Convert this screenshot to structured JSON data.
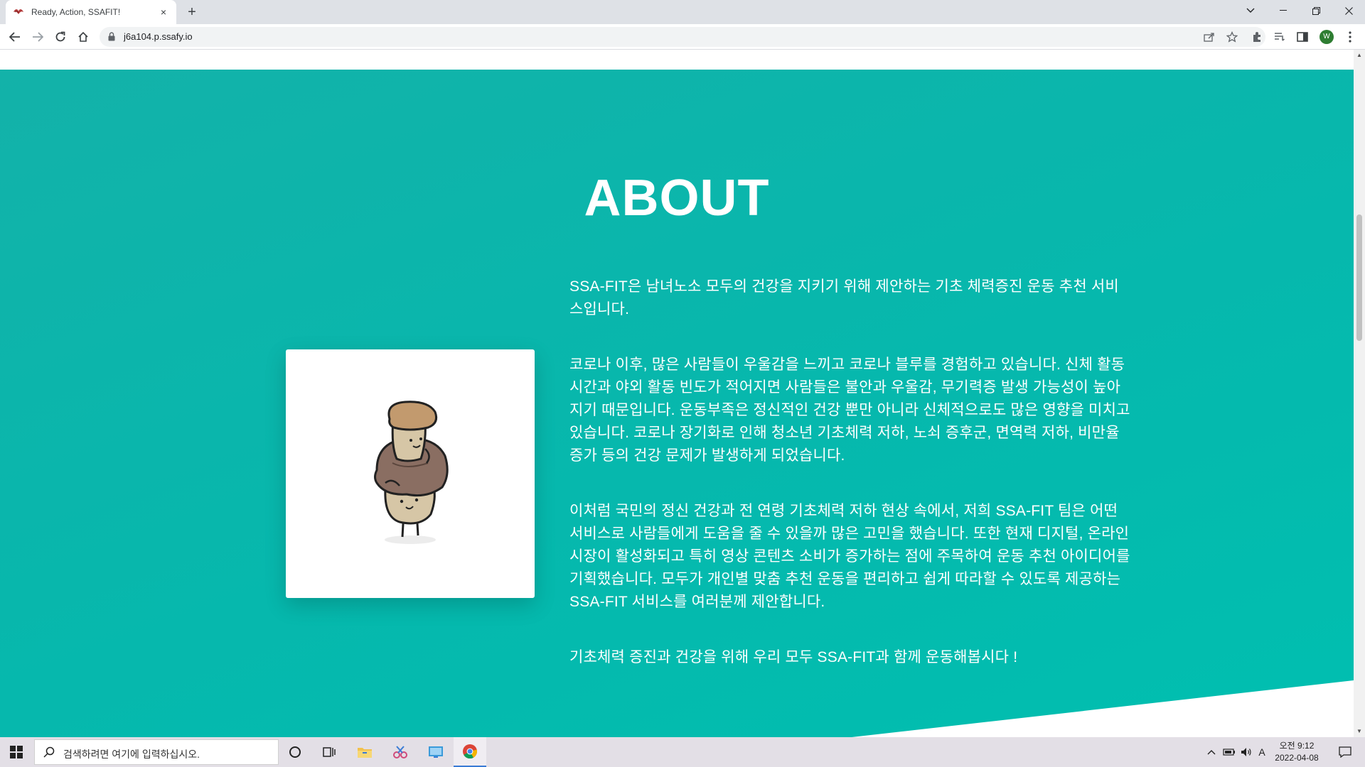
{
  "browser": {
    "tab_title": "Ready, Action, SSAFIT!",
    "tab_close": "×",
    "new_tab": "+",
    "url": "j6a104.p.ssafy.io",
    "profile_initial": "W"
  },
  "about": {
    "title": "ABOUT",
    "paragraphs": [
      "SSA-FIT은 남녀노소 모두의 건강을 지키기 위해 제안하는 기초 체력증진 운동 추천 서비스입니다.",
      "코로나 이후, 많은 사람들이 우울감을 느끼고 코로나 블루를 경험하고 있습니다. 신체 활동 시간과 야외 활동 빈도가 적어지면 사람들은 불안과 우울감, 무기력증 발생 가능성이 높아지기 때문입니다. 운동부족은 정신적인 건강 뿐만 아니라 신체적으로도 많은 영향을 미치고 있습니다. 코로나 장기화로 인해 청소년 기초체력 저하, 노쇠 증후군, 면역력 저하, 비만율 증가 등의 건강 문제가 발생하게 되었습니다.",
      "이처럼 국민의 정신 건강과 전 연령 기초체력 저하 현상 속에서, 저희 SSA-FIT 팀은 어떤 서비스로 사람들에게 도움을 줄 수 있을까 많은 고민을 했습니다. 또한 현재 디지털, 온라인 시장이 활성화되고 특히 영상 콘텐츠 소비가 증가하는 점에 주목하여 운동 추천 아이디어를 기획했습니다. 모두가 개인별 맞춤 추천 운동을 편리하고 쉽게 따라할 수 있도록 제공하는 SSA-FIT 서비스를 여러분께 제안합니다.",
      "기초체력 증진과 건강을 위해 우리 모두 SSA-FIT과 함께 운동해봅시다 !"
    ],
    "image_icon": "mushroom-character-icon"
  },
  "taskbar": {
    "search_placeholder": "검색하려면 여기에 입력하십시오.",
    "time": "오전 9:12",
    "date": "2022-04-08",
    "ime": "A"
  },
  "colors": {
    "section_bg": "#06b8ad",
    "text": "#ffffff"
  }
}
